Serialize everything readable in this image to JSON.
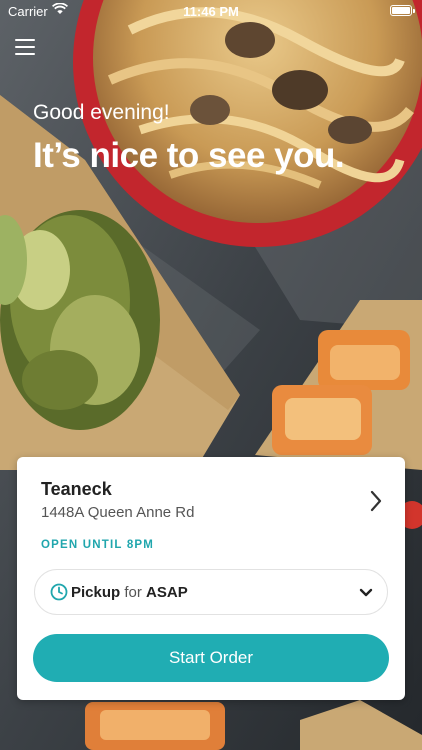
{
  "status_bar": {
    "carrier": "Carrier",
    "time": "11:46 PM"
  },
  "hero": {
    "greeting": "Good evening!",
    "headline": "It’s nice to see you."
  },
  "location": {
    "name": "Teaneck",
    "address": "1448A Queen Anne Rd",
    "hours_status": "OPEN UNTIL 8PM"
  },
  "order_mode": {
    "mode": "Pickup",
    "connector": "for",
    "time": "ASAP"
  },
  "cta": {
    "label": "Start Order"
  },
  "icons": [
    "menu-icon",
    "wifi-icon",
    "battery-icon",
    "chevron-right-icon",
    "clock-icon",
    "chevron-down-icon"
  ],
  "colors": {
    "accent": "#20adb3",
    "status_text": "#20a6ad"
  }
}
